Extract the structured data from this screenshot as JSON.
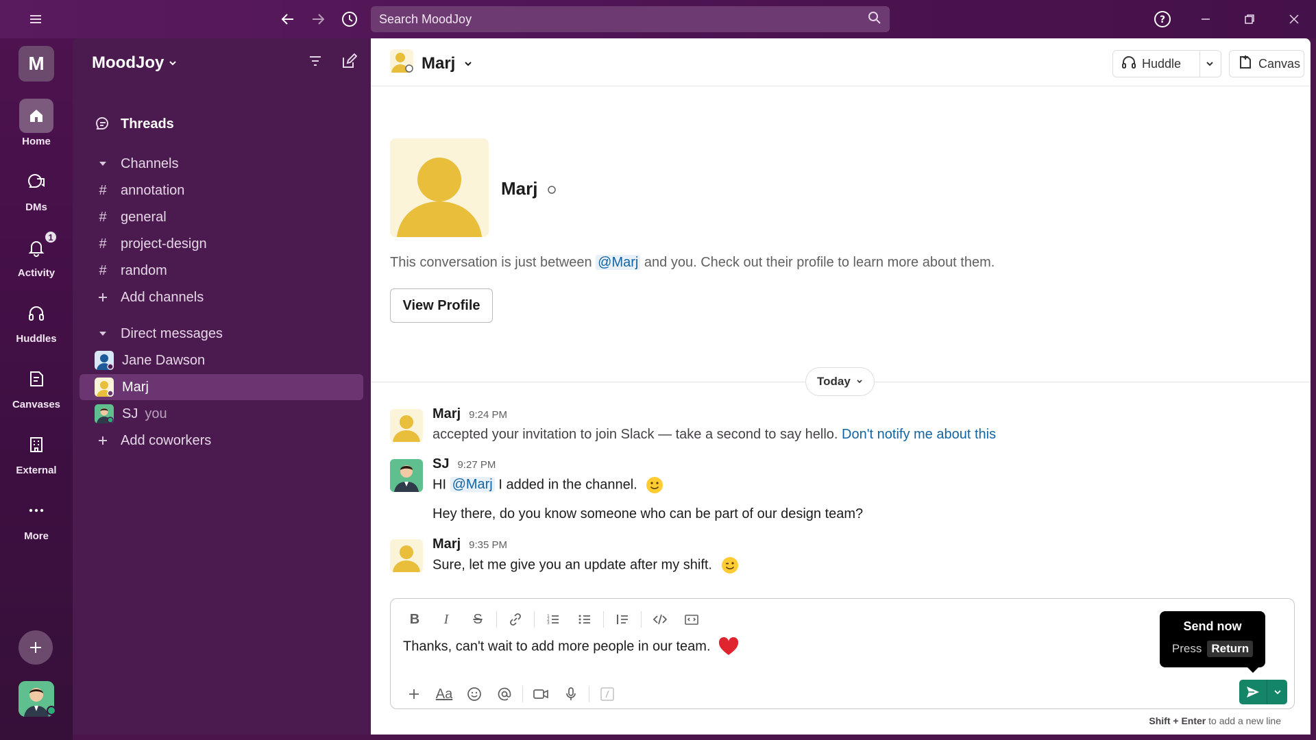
{
  "titlebar": {
    "search_placeholder": "Search MoodJoy"
  },
  "rail": {
    "workspace_initial": "M",
    "items": [
      {
        "label": "Home",
        "icon": "home-icon"
      },
      {
        "label": "DMs",
        "icon": "dms-icon"
      },
      {
        "label": "Activity",
        "icon": "bell-icon",
        "badge": "1"
      },
      {
        "label": "Huddles",
        "icon": "headphones-icon"
      },
      {
        "label": "Canvases",
        "icon": "canvas-icon"
      },
      {
        "label": "External",
        "icon": "building-icon"
      },
      {
        "label": "More",
        "icon": "more-icon"
      }
    ]
  },
  "sidebar": {
    "workspace_name": "MoodJoy",
    "threads": "Threads",
    "channels_header": "Channels",
    "channels": [
      "annotation",
      "general",
      "project-design",
      "random"
    ],
    "add_channels": "Add channels",
    "dm_header": "Direct messages",
    "dms": [
      {
        "name": "Jane Dawson",
        "suffix": ""
      },
      {
        "name": "Marj",
        "suffix": ""
      },
      {
        "name": "SJ",
        "suffix": "you"
      }
    ],
    "add_coworkers": "Add coworkers"
  },
  "conversation": {
    "title": "Marj",
    "huddle_label": "Huddle",
    "canvas_label": "Canvas",
    "intro_name": "Marj",
    "intro_pre": "This conversation is just between",
    "intro_mention": "@Marj",
    "intro_post": "and you. Check out their profile to learn more about them.",
    "view_profile": "View Profile",
    "date_divider": "Today"
  },
  "messages": [
    {
      "author": "Marj",
      "time": "9:24 PM",
      "text": "accepted your invitation to join Slack — take a second to say hello.",
      "link": "Don't notify me about this"
    },
    {
      "author": "SJ",
      "time": "9:27 PM",
      "pre": "HI",
      "mention": "@Marj",
      "post": "I added in the channel.",
      "text2": "Hey there, do you know someone who can be part of our design team?"
    },
    {
      "author": "Marj",
      "time": "9:35 PM",
      "text": "Sure, let me give you an update after my shift."
    }
  ],
  "composer": {
    "draft": "Thanks, can't wait to add more people in our team.",
    "tooltip_title": "Send now",
    "tooltip_press": "Press",
    "tooltip_key": "Return",
    "hint_key": "Shift + Enter",
    "hint_text": "to add a new line"
  },
  "colors": {
    "aubergine": "#4a154b",
    "send_green": "#148567",
    "link_blue": "#1264a3"
  }
}
